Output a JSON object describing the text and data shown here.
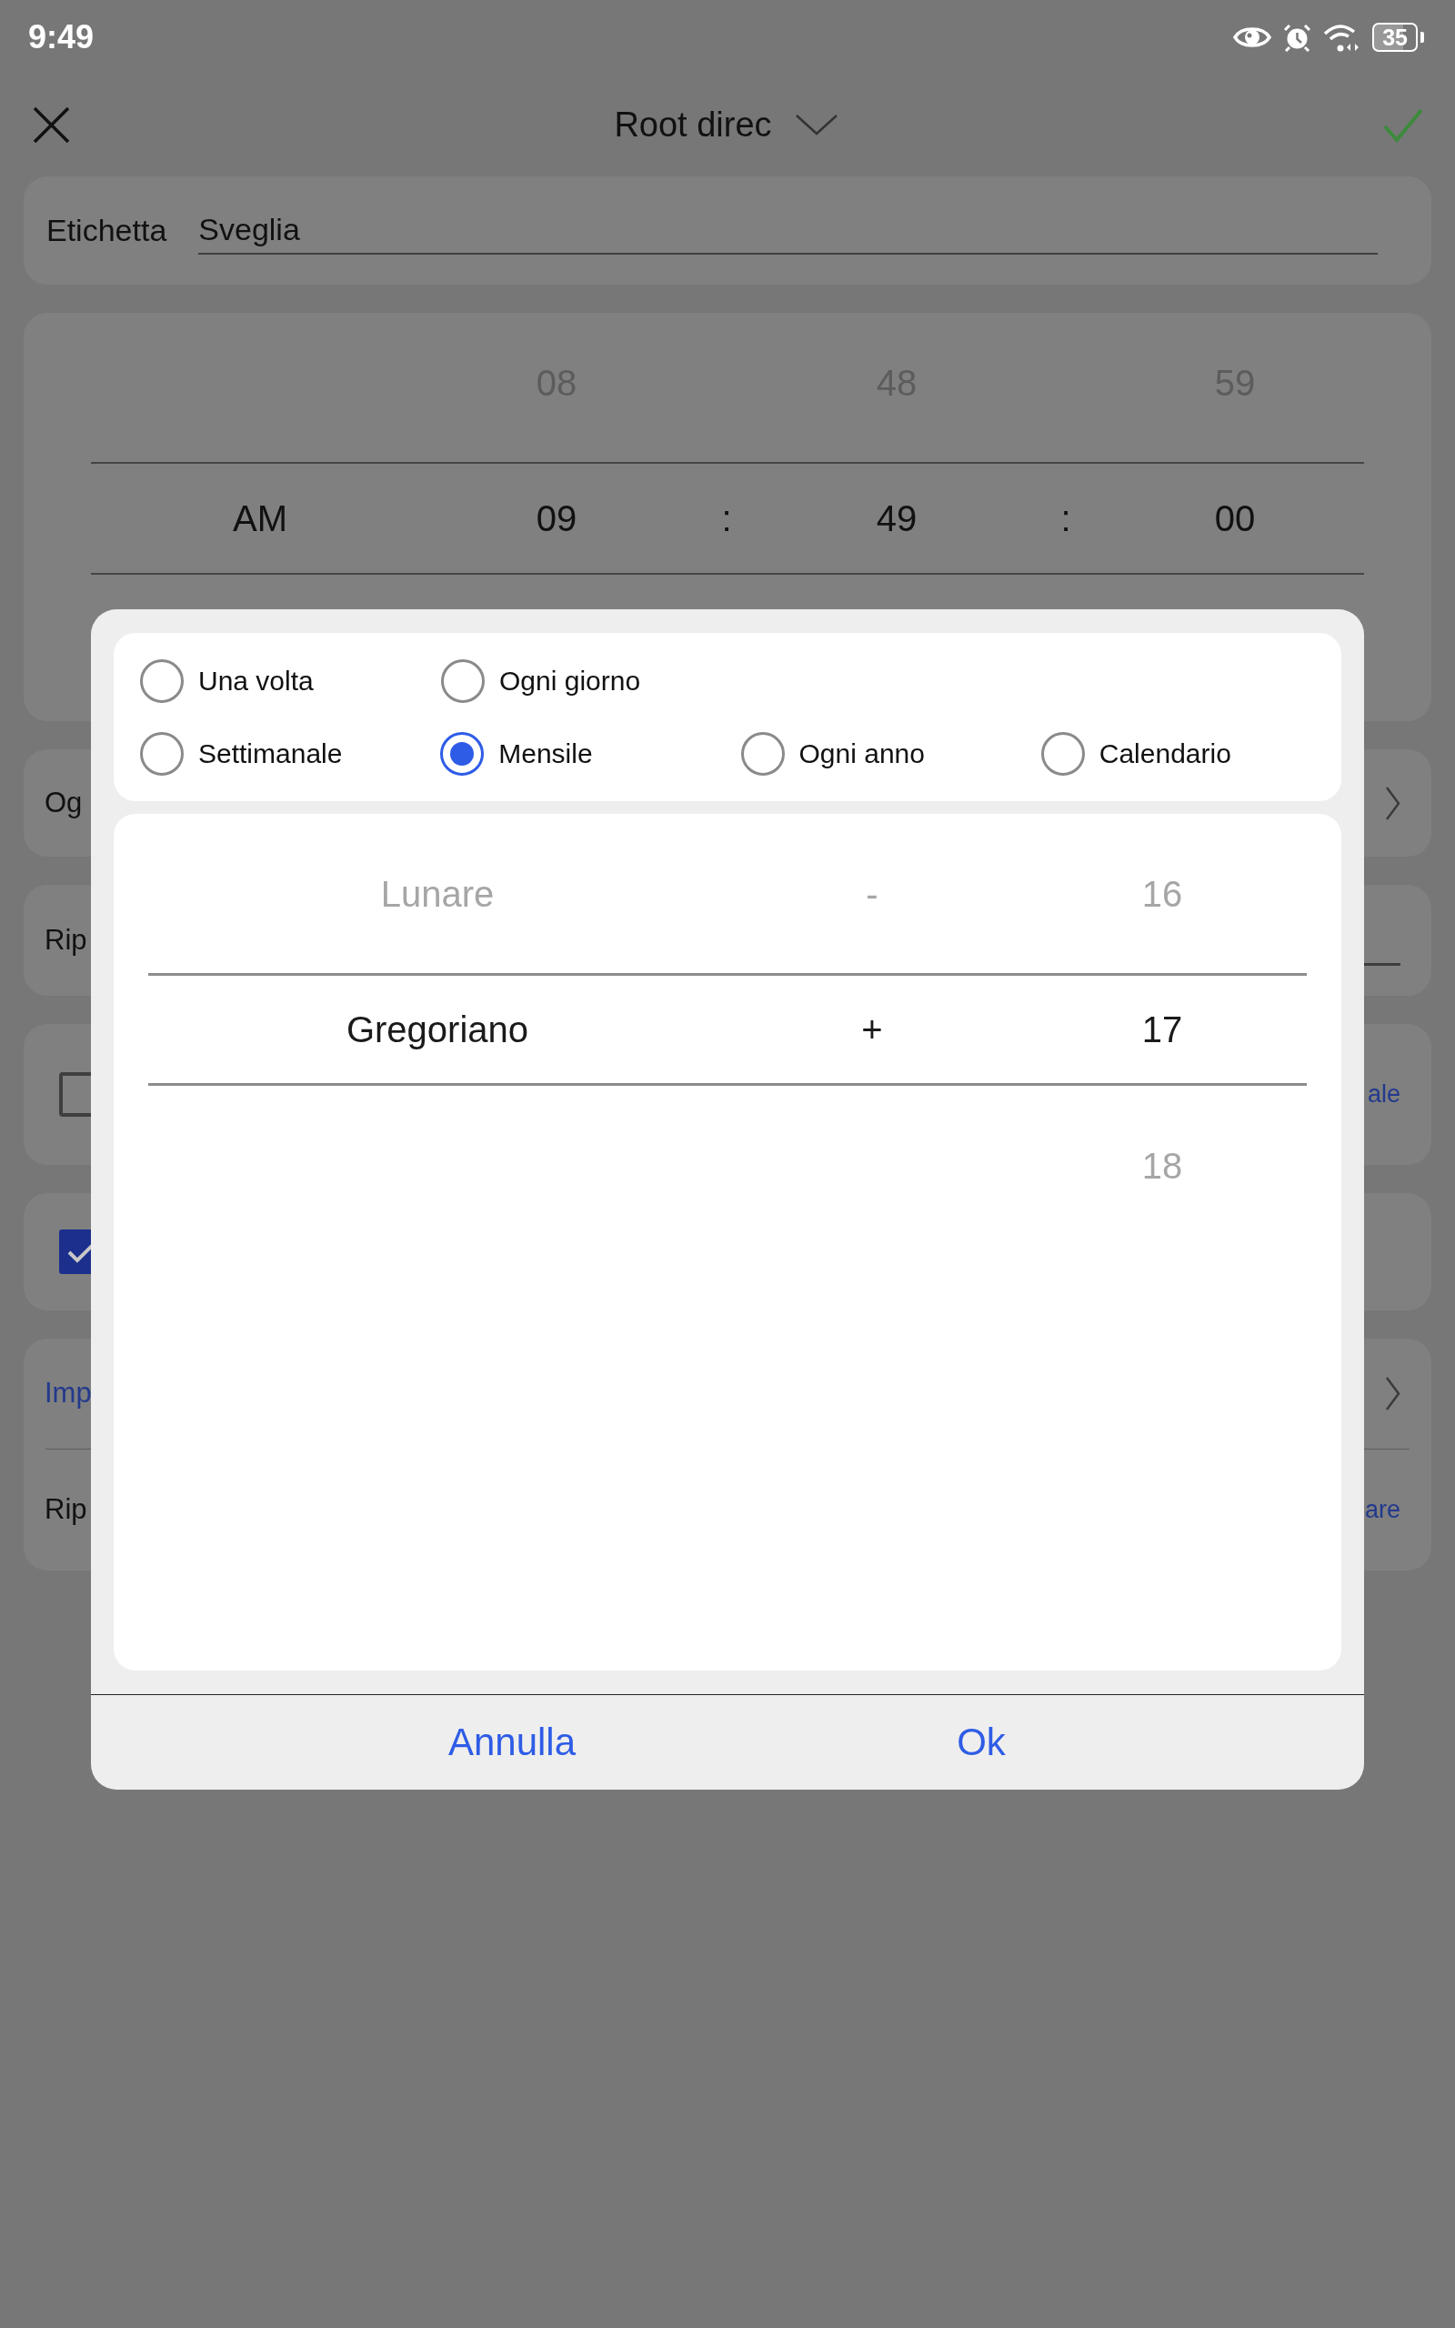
{
  "status_bar": {
    "time": "9:49",
    "battery": "35"
  },
  "header": {
    "title": "Root direc"
  },
  "label_card": {
    "label": "Etichetta",
    "value": "Sveglia"
  },
  "time_picker": {
    "columns": [
      {
        "kind": "wheel",
        "items": [
          {
            "text": "AM",
            "selected": true
          }
        ]
      },
      {
        "kind": "wheel",
        "items": [
          {
            "text": "08",
            "selected": false
          },
          {
            "text": "09",
            "selected": true
          }
        ]
      },
      {
        "kind": "separator",
        "text": ":"
      },
      {
        "kind": "wheel",
        "items": [
          {
            "text": "48",
            "selected": false
          },
          {
            "text": "49",
            "selected": true
          }
        ]
      },
      {
        "kind": "separator",
        "text": ":"
      },
      {
        "kind": "wheel",
        "items": [
          {
            "text": "59",
            "selected": false
          },
          {
            "text": "00",
            "selected": true
          }
        ]
      }
    ]
  },
  "settings_cards": [
    {
      "rows": [
        {
          "kind": "nav",
          "text": "Og",
          "link": false
        }
      ]
    },
    {
      "rows": [
        {
          "kind": "field",
          "text": "Rip"
        }
      ]
    },
    {
      "rows": [
        {
          "kind": "checkbox",
          "checked": false,
          "trailing": "ale"
        }
      ]
    },
    {
      "rows": [
        {
          "kind": "checkbox",
          "checked": true
        }
      ]
    },
    {
      "rows": [
        {
          "kind": "nav",
          "text": "Imp",
          "link": true
        },
        {
          "kind": "value",
          "text": "Rip",
          "trailing": "are"
        }
      ]
    }
  ],
  "dialog": {
    "repeat_options": [
      [
        {
          "label": "Una volta",
          "selected": false
        },
        {
          "label": "Ogni giorno",
          "selected": false
        }
      ],
      [
        {
          "label": "Settimanale",
          "selected": false
        },
        {
          "label": "Mensile",
          "selected": true
        },
        {
          "label": "Ogni anno",
          "selected": false
        },
        {
          "label": "Calendario",
          "selected": false
        }
      ]
    ],
    "calendar_picker": {
      "columns": [
        {
          "kind": "wheel",
          "items": [
            {
              "text": "Lunare",
              "selected": false
            },
            {
              "text": "Gregoriano",
              "selected": true
            }
          ]
        },
        {
          "kind": "wheel",
          "items": [
            {
              "text": "-",
              "selected": false
            },
            {
              "text": "+",
              "selected": true
            }
          ]
        },
        {
          "kind": "wheel",
          "items": [
            {
              "text": "16",
              "selected": false
            },
            {
              "text": "17",
              "selected": true
            },
            {
              "text": "18",
              "selected": false
            }
          ]
        }
      ]
    },
    "buttons": [
      {
        "label": "Annulla"
      },
      {
        "label": "Ok"
      }
    ]
  }
}
